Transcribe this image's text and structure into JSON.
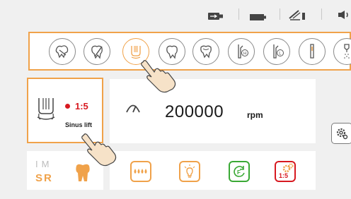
{
  "colors": {
    "accent": "#f0a24a",
    "alert_red": "#d71920",
    "green": "#3aa935",
    "background": "#f0f0f0"
  },
  "status_bar": {
    "icons": [
      "usb-stick-icon",
      "battery-icon",
      "signal-icon",
      "speaker-icon"
    ]
  },
  "handpieces": [
    {
      "name": "scaler-handpiece-icon",
      "selected": false
    },
    {
      "name": "endo-handpiece-icon",
      "selected": false
    },
    {
      "name": "implant-handpiece-icon",
      "selected": true
    },
    {
      "name": "tooth-handpiece-icon",
      "selected": false
    },
    {
      "name": "restorative-handpiece-icon",
      "selected": false
    },
    {
      "name": "high-speed-handpiece-icon",
      "letter": "H",
      "selected": false
    },
    {
      "name": "low-speed-handpiece-icon",
      "letter": "L",
      "selected": false
    },
    {
      "name": "micromotor-icon",
      "selected": false
    },
    {
      "name": "spray-handpiece-icon",
      "selected": false
    }
  ],
  "program": {
    "ratio": "1:5",
    "label": "Sinus lift"
  },
  "speed": {
    "value": "200000",
    "unit": "rpm"
  },
  "ims": {
    "top": "IM",
    "bottom": "SR"
  },
  "functions": {
    "gear_label": "1:5",
    "items": [
      "water-spray-icon",
      "light-icon",
      "rotation-direction-icon",
      "gear-ratio-icon"
    ]
  }
}
